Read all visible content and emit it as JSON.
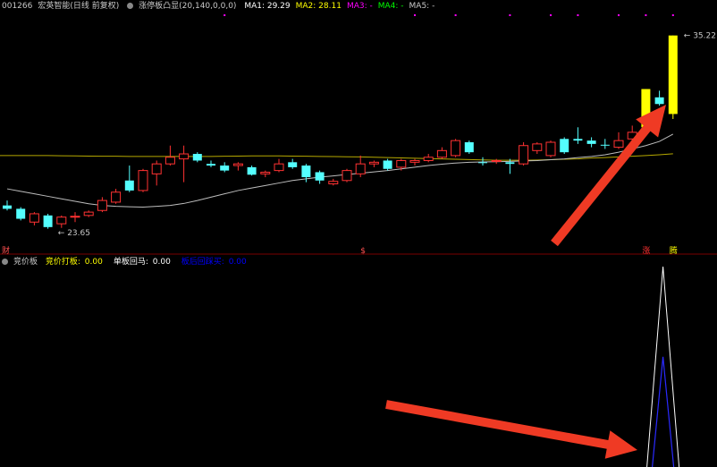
{
  "chart_data": {
    "type": "candlestick",
    "upper": {
      "stock_code": "001266",
      "stock_name": "宏英智能",
      "period_info": "(日线 前复权)",
      "indicator_name": "涨停板凸显",
      "indicator_params": "(20,140,0,0,0)",
      "ma": [
        {
          "label": "MA1:",
          "value": "29.29",
          "color": "#ffffff"
        },
        {
          "label": "MA2:",
          "value": "28.11",
          "color": "#ffff00"
        },
        {
          "label": "MA3:",
          "value": "-",
          "color": "#ff00ff"
        },
        {
          "label": "MA4:",
          "value": "-",
          "color": "#00ff00"
        },
        {
          "label": "MA5:",
          "value": "-",
          "color": "#c8c8c8"
        }
      ],
      "ylim": [
        22.4,
        36.6
      ],
      "high_label": "35.22",
      "low_label": "23.65",
      "left_tag": "财",
      "mid_tag": "$",
      "tag_zhang": "涨",
      "tag_teng": "腾",
      "candles": [
        {
          "o": 25.0,
          "h": 25.3,
          "l": 24.7,
          "c": 24.8,
          "cl": "cyan"
        },
        {
          "o": 24.8,
          "h": 24.9,
          "l": 24.1,
          "c": 24.2,
          "cl": "cyan"
        },
        {
          "o": 24.0,
          "h": 24.6,
          "l": 23.8,
          "c": 24.5,
          "cl": "red"
        },
        {
          "o": 24.4,
          "h": 24.5,
          "l": 23.6,
          "c": 23.7,
          "cl": "cyan"
        },
        {
          "o": 23.9,
          "h": 24.4,
          "l": 23.65,
          "c": 24.3,
          "cl": "red"
        },
        {
          "o": 24.3,
          "h": 24.6,
          "l": 24.0,
          "c": 24.35,
          "cl": "red"
        },
        {
          "o": 24.4,
          "h": 24.7,
          "l": 24.3,
          "c": 24.6,
          "cl": "red"
        },
        {
          "o": 24.7,
          "h": 25.5,
          "l": 24.6,
          "c": 25.3,
          "cl": "red"
        },
        {
          "o": 25.2,
          "h": 26.0,
          "l": 25.1,
          "c": 25.8,
          "cl": "red"
        },
        {
          "o": 26.5,
          "h": 27.4,
          "l": 25.8,
          "c": 25.9,
          "cl": "cyan"
        },
        {
          "o": 25.9,
          "h": 27.2,
          "l": 25.8,
          "c": 27.1,
          "cl": "red"
        },
        {
          "o": 26.9,
          "h": 27.7,
          "l": 26.2,
          "c": 27.5,
          "cl": "red"
        },
        {
          "o": 27.5,
          "h": 28.6,
          "l": 27.4,
          "c": 27.9,
          "cl": "red"
        },
        {
          "o": 27.8,
          "h": 28.6,
          "l": 26.4,
          "c": 28.1,
          "cl": "red"
        },
        {
          "o": 28.1,
          "h": 28.2,
          "l": 27.6,
          "c": 27.7,
          "cl": "cyan"
        },
        {
          "o": 27.5,
          "h": 27.7,
          "l": 27.3,
          "c": 27.4,
          "cl": "cyan"
        },
        {
          "o": 27.4,
          "h": 27.6,
          "l": 27.0,
          "c": 27.1,
          "cl": "cyan"
        },
        {
          "o": 27.4,
          "h": 27.6,
          "l": 27.1,
          "c": 27.5,
          "cl": "red"
        },
        {
          "o": 27.3,
          "h": 27.4,
          "l": 26.8,
          "c": 26.85,
          "cl": "cyan"
        },
        {
          "o": 26.9,
          "h": 27.1,
          "l": 26.7,
          "c": 27.0,
          "cl": "red"
        },
        {
          "o": 27.1,
          "h": 27.8,
          "l": 27.0,
          "c": 27.5,
          "cl": "red"
        },
        {
          "o": 27.6,
          "h": 27.8,
          "l": 27.2,
          "c": 27.3,
          "cl": "cyan"
        },
        {
          "o": 27.4,
          "h": 27.5,
          "l": 26.4,
          "c": 26.7,
          "cl": "cyan"
        },
        {
          "o": 27.0,
          "h": 27.1,
          "l": 26.3,
          "c": 26.5,
          "cl": "cyan"
        },
        {
          "o": 26.3,
          "h": 26.6,
          "l": 26.2,
          "c": 26.45,
          "cl": "red"
        },
        {
          "o": 26.5,
          "h": 27.2,
          "l": 26.4,
          "c": 27.1,
          "cl": "red"
        },
        {
          "o": 26.9,
          "h": 28.0,
          "l": 26.7,
          "c": 27.5,
          "cl": "red"
        },
        {
          "o": 27.5,
          "h": 27.7,
          "l": 27.3,
          "c": 27.6,
          "cl": "red"
        },
        {
          "o": 27.7,
          "h": 27.8,
          "l": 27.1,
          "c": 27.2,
          "cl": "cyan"
        },
        {
          "o": 27.3,
          "h": 27.8,
          "l": 27.1,
          "c": 27.7,
          "cl": "red"
        },
        {
          "o": 27.6,
          "h": 27.8,
          "l": 27.4,
          "c": 27.7,
          "cl": "red"
        },
        {
          "o": 27.7,
          "h": 28.1,
          "l": 27.6,
          "c": 27.9,
          "cl": "red"
        },
        {
          "o": 27.9,
          "h": 28.5,
          "l": 27.8,
          "c": 28.3,
          "cl": "red"
        },
        {
          "o": 28.0,
          "h": 29.0,
          "l": 27.9,
          "c": 28.9,
          "cl": "red"
        },
        {
          "o": 28.8,
          "h": 28.9,
          "l": 28.1,
          "c": 28.2,
          "cl": "cyan"
        },
        {
          "o": 27.6,
          "h": 27.9,
          "l": 27.4,
          "c": 27.55,
          "cl": "cyan"
        },
        {
          "o": 27.7,
          "h": 27.8,
          "l": 27.5,
          "c": 27.65,
          "cl": "red"
        },
        {
          "o": 27.6,
          "h": 27.8,
          "l": 26.9,
          "c": 27.5,
          "cl": "cyan"
        },
        {
          "o": 27.5,
          "h": 28.8,
          "l": 27.4,
          "c": 28.6,
          "cl": "red"
        },
        {
          "o": 28.3,
          "h": 28.8,
          "l": 28.1,
          "c": 28.7,
          "cl": "red"
        },
        {
          "o": 28.0,
          "h": 28.9,
          "l": 27.9,
          "c": 28.8,
          "cl": "red"
        },
        {
          "o": 28.2,
          "h": 29.1,
          "l": 28.1,
          "c": 29.0,
          "cl": "cyan"
        },
        {
          "o": 29.0,
          "h": 29.7,
          "l": 28.7,
          "c": 28.9,
          "cl": "cyan"
        },
        {
          "o": 28.9,
          "h": 29.1,
          "l": 28.5,
          "c": 28.7,
          "cl": "cyan"
        },
        {
          "o": 28.6,
          "h": 29.0,
          "l": 28.4,
          "c": 28.65,
          "cl": "cyan"
        },
        {
          "o": 28.5,
          "h": 29.4,
          "l": 28.4,
          "c": 28.9,
          "cl": "red"
        },
        {
          "o": 29.0,
          "h": 29.8,
          "l": 28.8,
          "c": 29.4,
          "cl": "red"
        },
        {
          "o": 29.7,
          "h": 32.0,
          "l": 29.6,
          "c": 32.0,
          "cl": "yellow"
        },
        {
          "o": 31.5,
          "h": 31.9,
          "l": 31.0,
          "c": 31.1,
          "cl": "cyan"
        },
        {
          "o": 30.5,
          "h": 35.22,
          "l": 30.2,
          "c": 35.22,
          "cl": "yellow"
        }
      ],
      "ma1": [
        26.0,
        25.85,
        25.7,
        25.55,
        25.4,
        25.25,
        25.1,
        25.0,
        24.95,
        24.92,
        24.9,
        24.95,
        25.0,
        25.12,
        25.3,
        25.5,
        25.7,
        25.9,
        26.05,
        26.2,
        26.35,
        26.5,
        26.6,
        26.7,
        26.78,
        26.86,
        26.94,
        27.02,
        27.1,
        27.2,
        27.3,
        27.4,
        27.48,
        27.55,
        27.6,
        27.62,
        27.63,
        27.65,
        27.68,
        27.7,
        27.75,
        27.8,
        27.88,
        27.95,
        28.05,
        28.2,
        28.4,
        28.6,
        28.85,
        29.29
      ],
      "ma2_flat": [
        28.0,
        28.0,
        28.0,
        28.0,
        27.99,
        27.98,
        27.97,
        27.96,
        27.96,
        27.95,
        27.95,
        27.95,
        27.95,
        27.95,
        27.95,
        27.95,
        27.96,
        27.97,
        27.98,
        27.98,
        27.98,
        27.97,
        27.96,
        27.95,
        27.94,
        27.93,
        27.92,
        27.9,
        27.88,
        27.86,
        27.84,
        27.82,
        27.8,
        27.78,
        27.76,
        27.74,
        27.72,
        27.72,
        27.72,
        27.73,
        27.75,
        27.78,
        27.8,
        27.85,
        27.88,
        27.92,
        27.96,
        28.0,
        28.05,
        28.11
      ],
      "markers": [
        {
          "i": 16,
          "color": "#ff00ff"
        },
        {
          "i": 30,
          "color": "#ff00ff"
        },
        {
          "i": 33,
          "color": "#ff00ff"
        },
        {
          "i": 37,
          "color": "#ff00ff"
        },
        {
          "i": 40,
          "color": "#ff00ff"
        },
        {
          "i": 42,
          "color": "#ff00ff"
        },
        {
          "i": 45,
          "color": "#ff00ff"
        },
        {
          "i": 47,
          "color": "#ff00ff"
        },
        {
          "i": 49,
          "color": "#ff00ff"
        }
      ]
    },
    "lower": {
      "indicator_name": "竞价板",
      "items": [
        {
          "label": "竞价打板:",
          "value": "0.00",
          "color": "#ffff00"
        },
        {
          "label": "单板回马:",
          "value": "0.00",
          "color": "#ffffff"
        },
        {
          "label": "板后回踩买:",
          "value": "0.00",
          "color": "#0000ff"
        }
      ],
      "spike_index": 48,
      "spike_values": {
        "white": 1.0,
        "blue": 0.55
      },
      "ylim": [
        0,
        1.0
      ]
    }
  }
}
